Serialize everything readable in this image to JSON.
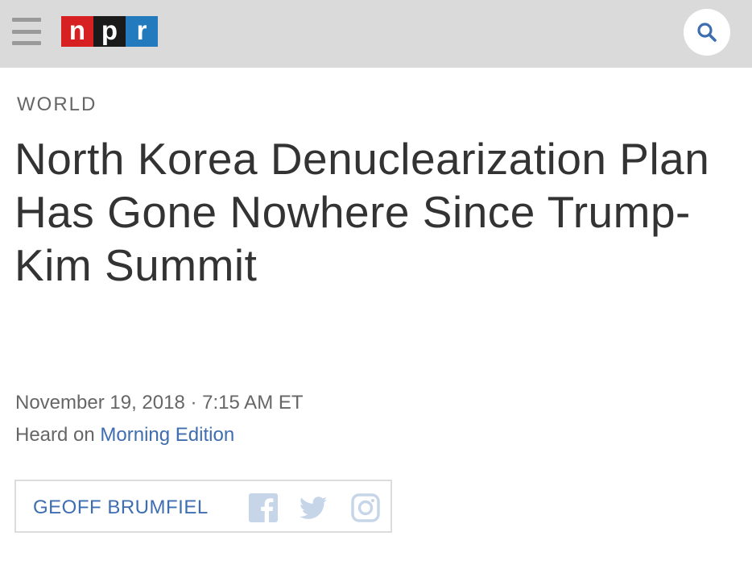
{
  "header": {
    "logo": [
      "n",
      "p",
      "r"
    ],
    "menu_icon": "hamburger-menu-icon",
    "search_icon": "search-icon",
    "bar_color": "#dadada"
  },
  "article": {
    "slug": "WORLD",
    "title": "North Korea Denuclearization Plan Has Gone Nowhere Since Trump-Kim Summit",
    "date": "November 19, 2018 · 7:15 AM ET",
    "heard_prefix": "Heard on",
    "program": "Morning Edition"
  },
  "byline": {
    "author": "GEOFF BRUMFIEL",
    "social_icons": [
      "facebook-icon",
      "twitter-icon",
      "instagram-icon"
    ]
  },
  "colors": {
    "link": "#3e6db0",
    "logo_red": "#d62021",
    "logo_black": "#1a1a1a",
    "logo_blue": "#237bbd"
  }
}
